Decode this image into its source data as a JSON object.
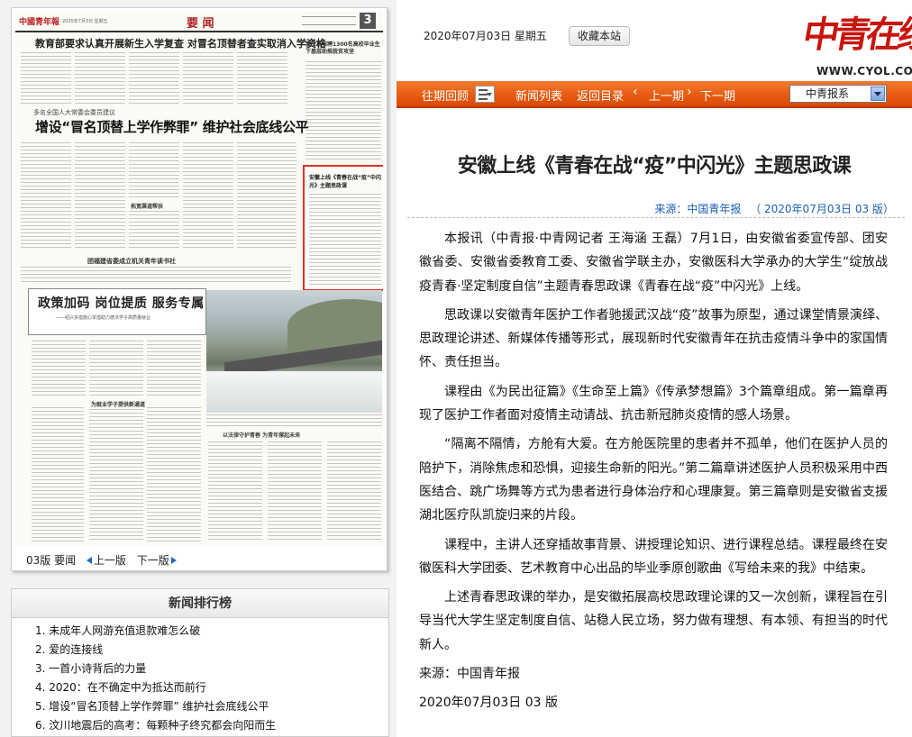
{
  "topbar": {
    "date": "2020年07月03日  星期五",
    "favorite_label": "收藏本站",
    "logo_cn": "中青在线",
    "logo_en": "WWW.CYOL.COM"
  },
  "nav": {
    "past_review": "往期回顾",
    "news_list": "新闻列表",
    "back_to_index": "返回目录",
    "prev_chevron": "‹",
    "prev_issue": "上一期",
    "next_chevron": "›",
    "next_issue": "下一期",
    "paper_select": "中青报系"
  },
  "paper": {
    "masthead_logo": "中國青年報",
    "masthead_date": "2020年7月3日 星期五",
    "section": "要 闻",
    "page_num": "3",
    "headline_top": "教育部要求认真开展新生入学复查  对冒名顶替者查实取消入学资格",
    "subline": "多名全国人大常委会委员建议",
    "headline_main": "增设“冒名顶替上学作弊罪”  维护社会底线公平",
    "headline_bottom": "团福建省委成立机关青年读书社",
    "side_headline": "重庆将招聘1300名高校毕业生下基层助推脱贫攻坚",
    "highlight_title": "安徽上线《青春在战“疫”中闪光》主题思政课",
    "policy_title": "政策加码  岗位提质  服务专属",
    "policy_sub": "——绍兴多措施心举措助力德法学子高质量就业",
    "col_headline_1": "拓宽渠道帮扶",
    "col_headline_2": "为就业学子提供新通道",
    "bottom_tabs": "以法律守护青春    为青年撑起未来"
  },
  "paper_nav": {
    "page_label": "03版 要闻",
    "prev": "上一版",
    "next": "下一版"
  },
  "ranking": {
    "title": "新闻排行榜",
    "items": [
      "1. 未成年人网游充值退款难怎么破",
      "2. 爱的连接线",
      "3. 一首小诗背后的力量",
      "4. 2020：在不确定中为抵达而前行",
      "5. 增设“冒名顶替上学作弊罪”  维护社会底线公平",
      "6. 汶川地震后的高考：每颗种子终究都会向阳而生"
    ]
  },
  "article": {
    "title": "安徽上线《青春在战“疫”中闪光》主题思政课",
    "source_meta": "来源：中国青年报",
    "date_meta": "（ 2020年07月03日   03 版）",
    "paragraphs": [
      "本报讯（中青报·中青网记者  王海涵  王磊）7月1日，由安徽省委宣传部、团安徽省委、安徽省委教育工委、安徽省学联主办，安徽医科大学承办的大学生“绽放战疫青春·坚定制度自信”主题青春思政课《青春在战“疫”中闪光》上线。",
      "思政课以安徽青年医护工作者驰援武汉战“疫”故事为原型，通过课堂情景演绎、思政理论讲述、新媒体传播等形式，展现新时代安徽青年在抗击疫情斗争中的家国情怀、责任担当。",
      "课程由《为民出征篇》《生命至上篇》《传承梦想篇》3个篇章组成。第一篇章再现了医护工作者面对疫情主动请战、抗击新冠肺炎疫情的感人场景。",
      "“隔离不隔情，方舱有大爱。在方舱医院里的患者并不孤单，他们在医护人员的陪护下，消除焦虑和恐惧，迎接生命新的阳光。”第二篇章讲述医护人员积极采用中西医结合、跳广场舞等方式为患者进行身体治疗和心理康复。第三篇章则是安徽省支援湖北医疗队凯旋归来的片段。",
      "课程中，主讲人还穿插故事背景、讲授理论知识、进行课程总结。课程最终在安徽医科大学团委、艺术教育中心出品的毕业季原创歌曲《写给未来的我》中结束。",
      "上述青春思政课的举办，是安徽拓展高校思政理论课的又一次创新，课程旨在引导当代大学生坚定制度自信、站稳人民立场，努力做有理想、有本领、有担当的时代新人。"
    ],
    "source_footer": "来源：中国青年报",
    "date_footer": "2020年07月03日 03 版"
  },
  "colors": {
    "nav_orange": "#e55a10",
    "logo_red": "#c8160e",
    "highlight_border": "#d32",
    "meta_blue": "#1a5fb4"
  }
}
